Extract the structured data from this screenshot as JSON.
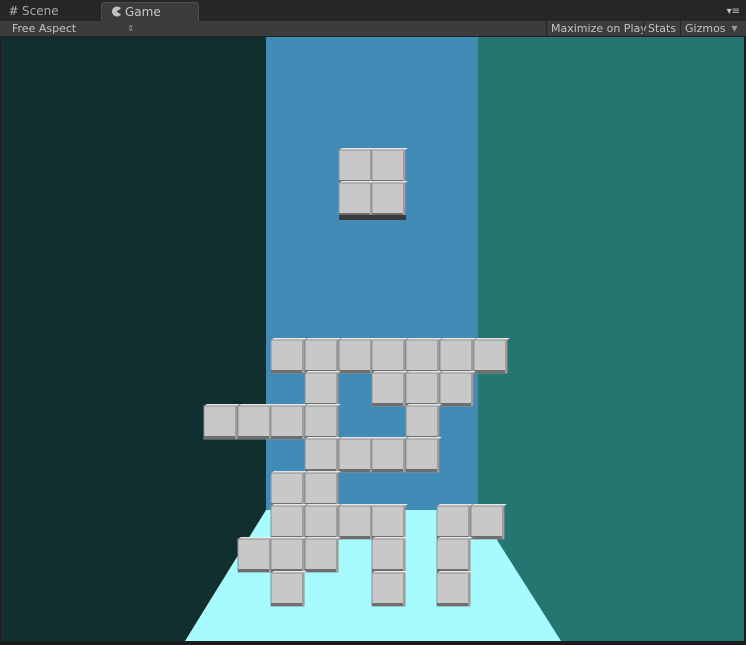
{
  "tabs": {
    "scene": {
      "label": "Scene",
      "icon": "grid-icon"
    },
    "game": {
      "label": "Game",
      "icon": "pacman-icon"
    },
    "panel_menu_icon": "panel-menu-icon"
  },
  "toolbar": {
    "aspect_label": "Free Aspect",
    "aspect_arrow_icon": "updown-arrows-icon",
    "maximize_label": "Maximize on Play",
    "stats_label": "Stats",
    "gizmos_label": "Gizmos",
    "gizmos_dropdown_icon": "triangle-down-icon"
  },
  "viewport": {
    "colors": {
      "left_wall": "#122f30",
      "back_wall": "#418bb7",
      "right_wall": "#257671",
      "floor": "#a5fbfe",
      "cube_face": "#c8c8c8"
    }
  }
}
